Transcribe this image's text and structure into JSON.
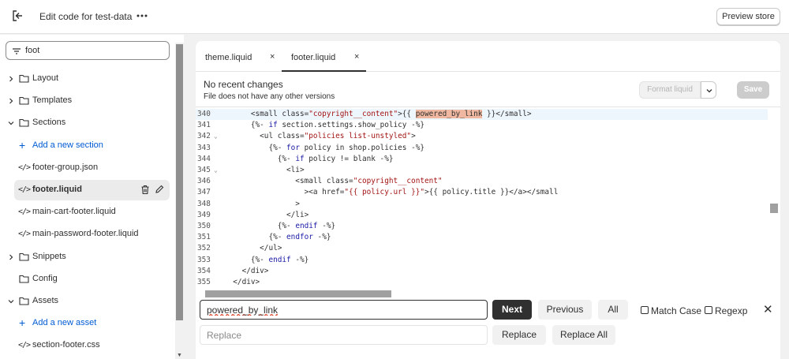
{
  "topbar": {
    "exit_icon": "exit-icon",
    "title": "Edit code for test-data",
    "more_icon": "ellipsis-icon",
    "preview_label": "Preview store"
  },
  "sidebar": {
    "search_value": "foot",
    "search_icon": "filter-icon",
    "items": [
      {
        "type": "folder",
        "label": "Layout",
        "expanded": false
      },
      {
        "type": "folder",
        "label": "Templates",
        "expanded": false
      },
      {
        "type": "folder",
        "label": "Sections",
        "expanded": true
      },
      {
        "type": "add",
        "label": "Add a new section"
      },
      {
        "type": "file",
        "label": "footer-group.json"
      },
      {
        "type": "file",
        "label": "footer.liquid",
        "active": true
      },
      {
        "type": "file",
        "label": "main-cart-footer.liquid"
      },
      {
        "type": "file",
        "label": "main-password-footer.liquid"
      },
      {
        "type": "folder",
        "label": "Snippets",
        "expanded": false
      },
      {
        "type": "folder-nochev",
        "label": "Config"
      },
      {
        "type": "folder",
        "label": "Assets",
        "expanded": true
      },
      {
        "type": "add",
        "label": "Add a new asset"
      },
      {
        "type": "file",
        "label": "section-footer.css"
      }
    ]
  },
  "editor": {
    "tabs": [
      {
        "label": "theme.liquid",
        "close": "×"
      },
      {
        "label": "footer.liquid",
        "close": "×",
        "active": true
      }
    ],
    "status_title": "No recent changes",
    "status_note": "File does not have any other versions",
    "format_label": "Format liquid",
    "save_label": "Save",
    "lines": [
      {
        "n": "340",
        "fold": "",
        "indent": "      ",
        "text": "<small class=\"copyright__content\">{{ powered_by_link }}</small>",
        "highlight": true
      },
      {
        "n": "341",
        "fold": "",
        "indent": "      ",
        "text": "{%- if section.settings.show_policy -%}"
      },
      {
        "n": "342",
        "fold": "⌄",
        "indent": "        ",
        "text": "<ul class=\"policies list-unstyled\">"
      },
      {
        "n": "343",
        "fold": "",
        "indent": "          ",
        "text": "{%- for policy in shop.policies -%}"
      },
      {
        "n": "344",
        "fold": "",
        "indent": "            ",
        "text": "{%- if policy != blank -%}"
      },
      {
        "n": "345",
        "fold": "⌄",
        "indent": "              ",
        "text": "<li>"
      },
      {
        "n": "346",
        "fold": "",
        "indent": "                ",
        "text": "<small class=\"copyright__content\""
      },
      {
        "n": "347",
        "fold": "",
        "indent": "                  ",
        "text": "><a href=\"{{ policy.url }}\">{{ policy.title }}</a></small"
      },
      {
        "n": "348",
        "fold": "",
        "indent": "                ",
        "text": ">"
      },
      {
        "n": "349",
        "fold": "",
        "indent": "              ",
        "text": "</li>"
      },
      {
        "n": "350",
        "fold": "",
        "indent": "            ",
        "text": "{%- endif -%}"
      },
      {
        "n": "351",
        "fold": "",
        "indent": "          ",
        "text": "{%- endfor -%}"
      },
      {
        "n": "352",
        "fold": "",
        "indent": "        ",
        "text": "</ul>"
      },
      {
        "n": "353",
        "fold": "",
        "indent": "      ",
        "text": "{%- endif -%}"
      },
      {
        "n": "354",
        "fold": "",
        "indent": "    ",
        "text": "</div>"
      },
      {
        "n": "355",
        "fold": "",
        "indent": "  ",
        "text": "</div>"
      }
    ]
  },
  "find": {
    "value": "powered_by_link",
    "next_label": "Next",
    "previous_label": "Previous",
    "all_label": "All",
    "match_case_label": "Match Case",
    "regexp_label": "Regexp",
    "close": "✕",
    "replace_placeholder": "Replace",
    "replace_label": "Replace",
    "replace_all_label": "Replace All"
  }
}
